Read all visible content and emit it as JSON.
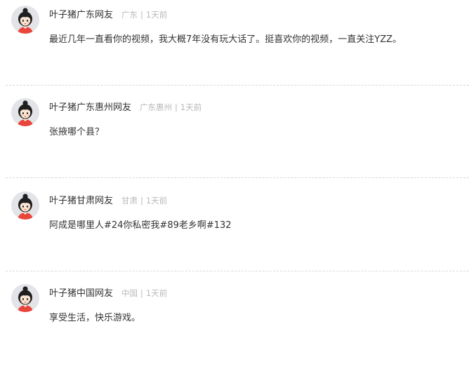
{
  "comments": [
    {
      "username": "叶子猪广东网友",
      "location": "广东",
      "separator": "|",
      "time": "1天前",
      "content": "最近几年一直看你的视频，我大概7年没有玩大话了。挺喜欢你的视频，一直关注YZZ。"
    },
    {
      "username": "叶子猪广东惠州网友",
      "location": "广东惠州",
      "separator": "|",
      "time": "1天前",
      "content": "张掖哪个县？"
    },
    {
      "username": "叶子猪甘肃网友",
      "location": "甘肃",
      "separator": "|",
      "time": "1天前",
      "content": "阿成是哪里人#24你私密我#89老乡啊#132"
    },
    {
      "username": "叶子猪中国网友",
      "location": "中国",
      "separator": "|",
      "time": "1天前",
      "content": "享受生活，快乐游戏。"
    }
  ],
  "colors": {
    "username": "#333333",
    "meta": "#b8b8b8",
    "content": "#333333",
    "avatar_bg": "#e2e4e7",
    "avatar_hair": "#1f1f1f",
    "avatar_shirt": "#e8463a"
  },
  "icons": {
    "avatar": "cartoon-girl-avatar-icon"
  }
}
